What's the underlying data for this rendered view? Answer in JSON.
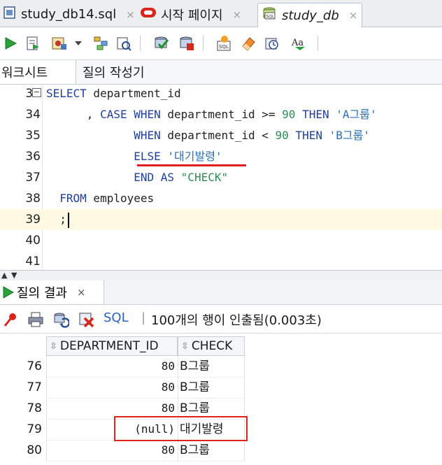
{
  "file_tabs": [
    {
      "label": "study_db14.sql",
      "icon": "sql-file-icon",
      "active": false
    },
    {
      "label": "시작 페이지",
      "icon": "oracle-logo-icon",
      "active": false
    },
    {
      "label": "study_db",
      "icon": "sql-worksheet-icon",
      "active": true
    }
  ],
  "close_glyph": "×",
  "sub_tabs": [
    {
      "label": "워크시트",
      "active": true
    },
    {
      "label": "질의 작성기",
      "active": false
    }
  ],
  "editor": {
    "lines": [
      {
        "n": "33",
        "parts": [
          [
            "kw",
            "SELECT"
          ],
          [
            "plain",
            " department_id"
          ]
        ]
      },
      {
        "n": "34",
        "parts": [
          [
            "plain",
            "      , "
          ],
          [
            "kw",
            "CASE WHEN"
          ],
          [
            "plain",
            " department_id >= "
          ],
          [
            "num",
            "90"
          ],
          [
            "plain",
            " "
          ],
          [
            "kw",
            "THEN"
          ],
          [
            "plain",
            " "
          ],
          [
            "str",
            "'A그룹'"
          ]
        ]
      },
      {
        "n": "35",
        "parts": [
          [
            "plain",
            "             "
          ],
          [
            "kw",
            "WHEN"
          ],
          [
            "plain",
            " department_id < "
          ],
          [
            "num",
            "90"
          ],
          [
            "plain",
            " "
          ],
          [
            "kw",
            "THEN"
          ],
          [
            "plain",
            " "
          ],
          [
            "str",
            "'B그룹'"
          ]
        ]
      },
      {
        "n": "36",
        "parts": [
          [
            "plain",
            "             "
          ],
          [
            "kw",
            "ELSE"
          ],
          [
            "plain",
            " "
          ],
          [
            "str",
            "'대기발령'"
          ]
        ]
      },
      {
        "n": "37",
        "parts": [
          [
            "plain",
            "             "
          ],
          [
            "kw",
            "END AS"
          ],
          [
            "plain",
            " "
          ],
          [
            "num",
            "\"CHECK\""
          ]
        ]
      },
      {
        "n": "38",
        "parts": [
          [
            "plain",
            "  "
          ],
          [
            "kw",
            "FROM"
          ],
          [
            "plain",
            " employees"
          ]
        ]
      },
      {
        "n": "39",
        "parts": [
          [
            "plain",
            "  ;"
          ]
        ]
      },
      {
        "n": "40",
        "parts": []
      },
      {
        "n": "41",
        "parts": []
      }
    ]
  },
  "results": {
    "tab_label": "질의 결과",
    "sql_label": "SQL",
    "status": "100개의 행이 인출됨(0.003초)",
    "columns": [
      "DEPARTMENT_ID",
      "CHECK"
    ],
    "rows": [
      {
        "n": "76",
        "dep": "80",
        "check": "B그룹"
      },
      {
        "n": "77",
        "dep": "80",
        "check": "B그룹"
      },
      {
        "n": "78",
        "dep": "80",
        "check": "B그룹"
      },
      {
        "n": "79",
        "dep": "(null)",
        "check": "대기발령"
      },
      {
        "n": "80",
        "dep": "80",
        "check": "B그룹"
      }
    ]
  },
  "colors": {
    "annotation": "#e0211c",
    "keyword": "#1f3f9c",
    "string": "#2b6fb0",
    "number": "#2e8b57"
  }
}
